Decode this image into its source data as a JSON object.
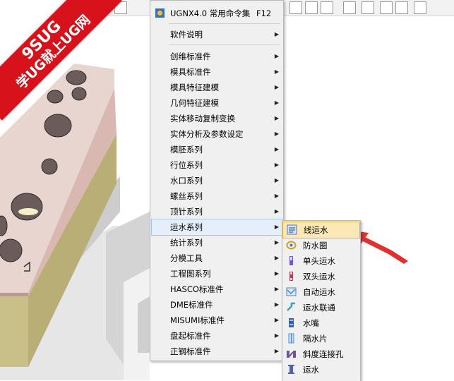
{
  "banner": {
    "line1": "9SUG",
    "line2": "学UG就上UG网"
  },
  "top_item": {
    "label": "UGNX4.0 常用命令集",
    "shortcut": "F12",
    "icon": "ugnx-icon"
  },
  "main_menu": [
    {
      "label": "软件说明",
      "arrow": "▶"
    },
    {
      "label": "创维标准件",
      "arrow": "▶"
    },
    {
      "label": "模具标准件",
      "arrow": "▶"
    },
    {
      "label": "模具特征建模",
      "arrow": "▶"
    },
    {
      "label": "几何特征建模",
      "arrow": "▶"
    },
    {
      "label": "实体移动复制变换",
      "arrow": "▶"
    },
    {
      "label": "实体分析及参数设定",
      "arrow": "▶"
    },
    {
      "label": "模胚系列",
      "arrow": "▶"
    },
    {
      "label": "行位系列",
      "arrow": "▶"
    },
    {
      "label": "水口系列",
      "arrow": "▶"
    },
    {
      "label": "螺丝系列",
      "arrow": "▶"
    },
    {
      "label": "顶针系列",
      "arrow": "▶"
    },
    {
      "label": "运水系列",
      "arrow": "▶",
      "highlighted": true
    },
    {
      "label": "统计系列",
      "arrow": "▶"
    },
    {
      "label": "分模工具",
      "arrow": "▶"
    },
    {
      "label": "工程图系列",
      "arrow": "▶"
    },
    {
      "label": "HASCO标准件",
      "arrow": "▶"
    },
    {
      "label": "DME标准件",
      "arrow": "▶"
    },
    {
      "label": "MISUMI标准件",
      "arrow": "▶"
    },
    {
      "label": "盘起标准件",
      "arrow": "▶"
    },
    {
      "label": "正钢标准件",
      "arrow": "▶"
    }
  ],
  "sub_menu": [
    {
      "label": "线运水",
      "icon": "line-cooling-icon",
      "color": "#4a78c0",
      "highlighted": true
    },
    {
      "label": "防水圈",
      "icon": "o-ring-icon",
      "color": "#d0a020"
    },
    {
      "label": "单头运水",
      "icon": "single-end-cooling-icon",
      "color": "#6a5acd"
    },
    {
      "label": "双头运水",
      "icon": "double-end-cooling-icon",
      "color": "#b04060"
    },
    {
      "label": "自动运水",
      "icon": "auto-cooling-icon",
      "color": "#5080c0"
    },
    {
      "label": "运水联通",
      "icon": "cooling-connect-icon",
      "color": "#3aa0c0"
    },
    {
      "label": "水嘴",
      "icon": "water-nozzle-icon",
      "color": "#3060b0"
    },
    {
      "label": "隔水片",
      "icon": "baffle-icon",
      "color": "#4a90d0"
    },
    {
      "label": "斜度连接孔",
      "icon": "angled-hole-icon",
      "color": "#7050a0"
    },
    {
      "label": "运水",
      "icon": "cooling-icon",
      "color": "#5060b0"
    }
  ],
  "colors": {
    "banner": "#d8121b",
    "arrow": "#e03030",
    "menu_bg": "#f0f0f0"
  }
}
